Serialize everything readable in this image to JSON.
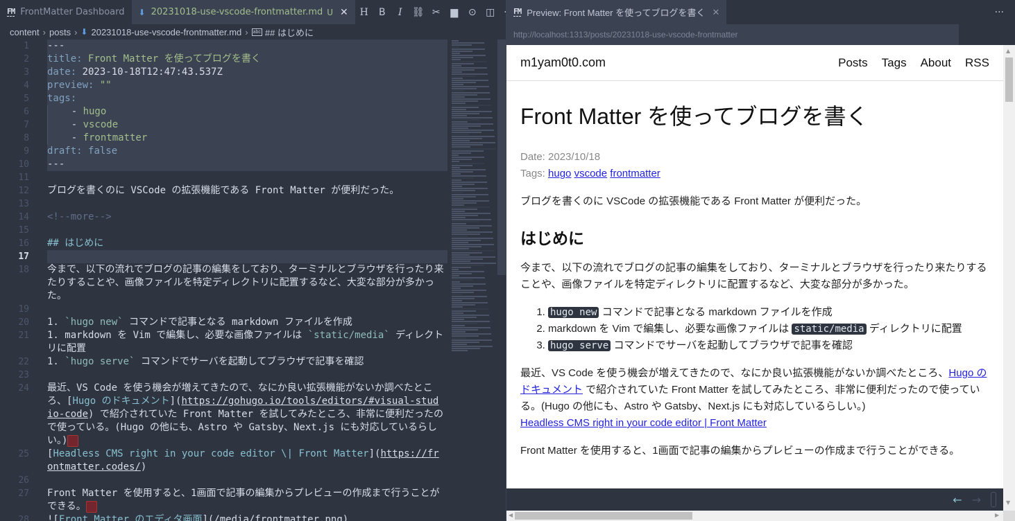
{
  "left_tabs": [
    {
      "label": "FrontMatter Dashboard",
      "icon": "fm-logo"
    },
    {
      "label": "20231018-use-vscode-frontmatter.md",
      "icon": "markdown-icon",
      "modified_badge": "U",
      "active": true
    }
  ],
  "toolbar": [
    {
      "name": "heading",
      "glyph": "H"
    },
    {
      "name": "bold",
      "glyph": "B"
    },
    {
      "name": "italic",
      "glyph": "I"
    },
    {
      "name": "link",
      "glyph": "⛓"
    },
    {
      "name": "cut",
      "glyph": "✂"
    },
    {
      "name": "image",
      "glyph": "▆"
    },
    {
      "name": "snippet",
      "glyph": "⊙"
    },
    {
      "name": "split-editor",
      "glyph": "◫"
    },
    {
      "name": "more",
      "glyph": "···"
    }
  ],
  "breadcrumb": [
    "content",
    "posts",
    "20231018-use-vscode-frontmatter.md",
    "## はじめに"
  ],
  "editor": {
    "current_line": 17,
    "lines": {
      "l1": "---",
      "l2_key": "title",
      "l2_val": "Front Matter を使ってブログを書く",
      "l3_key": "date",
      "l3_val": "2023-10-18T12:47:43.537Z",
      "l4_key": "preview",
      "l4_val": "\"\"",
      "l5_key": "tags",
      "l6": "hugo",
      "l7": "vscode",
      "l8": "frontmatter",
      "l9_key": "draft",
      "l9_val": "false",
      "l10": "---",
      "l12": "ブログを書くのに VSCode の拡張機能である Front Matter が便利だった。",
      "l14": "<!--more-->",
      "l16": "## はじめに",
      "l18": "今まで、以下の流れでブログの記事の編集をしており、ターミナルとブラウザを行ったり来たりすることや、画像ファイルを特定ディレクトリに配置するなど、大変な部分が多かった。",
      "l20_a": "1. ",
      "l20_code": "`hugo new`",
      "l20_b": " コマンドで記事となる markdown ファイルを作成",
      "l21_a": "1. markdown を Vim で編集し、必要な画像ファイルは ",
      "l21_code": "`static/media`",
      "l21_b": " ディレクトリに配置",
      "l22_a": "1. ",
      "l22_code": "`hugo serve`",
      "l22_b": " コマンドでサーバを起動してブラウザで記事を確認",
      "l24_a": "最近、VS Code を使う機会が増えてきたので、なにか良い拡張機能がないか調べたところ、[",
      "l24_linktext": "Hugo のドキュメント",
      "l24_b": "](",
      "l24_url": "https://gohugo.io/tools/editors/#visual-studio-code",
      "l24_c": ") で紹介されていた Front Matter を試してみたところ、非常に便利だったので使っている。(Hugo の他にも、Astro や Gatsby、Next.js にも対応しているらしい。)",
      "l25_a": "[",
      "l25_linktext": "Headless CMS right in your code editor \\| Front Matter",
      "l25_b": "](",
      "l25_url": "https://frontmatter.codes/",
      "l25_c": ")",
      "l27": "Front Matter を使用すると、1画面で記事の編集からプレビューの作成まで行うことができる。",
      "l28_a": "![",
      "l28_linktext": "Front Matter のエディタ画面",
      "l28_b": "](/media/frontmatter.png)"
    }
  },
  "preview": {
    "tab_label": "Preview: Front Matter を使ってブログを書く",
    "url": "http://localhost:1313/posts/20231018-use-vscode-frontmatter",
    "site_title": "m1yam0t0.com",
    "nav": [
      "Posts",
      "Tags",
      "About",
      "RSS"
    ],
    "title": "Front Matter を使ってブログを書く",
    "date_label": "Date: 2023/10/18",
    "tags_label": "Tags:",
    "tags": [
      "hugo",
      "vscode",
      "frontmatter"
    ],
    "intro": "ブログを書くのに VSCode の拡張機能である Front Matter が便利だった。",
    "h2": "はじめに",
    "p1": "今まで、以下の流れでブログの記事の編集をしており、ターミナルとブラウザを行ったり来たりすることや、画像ファイルを特定ディレクトリに配置するなど、大変な部分が多かった。",
    "list": [
      {
        "code": "hugo new",
        "text": " コマンドで記事となる markdown ファイルを作成"
      },
      {
        "pre": "markdown を Vim で編集し、必要な画像ファイルは ",
        "code": "static/media",
        "text": " ディレクトリに配置"
      },
      {
        "code": "hugo serve",
        "text": " コマンドでサーバを起動してブラウザで記事を確認"
      }
    ],
    "p2_a": "最近、VS Code を使う機会が増えてきたので、なにか良い拡張機能がないか調べたところ、",
    "p2_link": "Hugo のドキュメント",
    "p2_b": " で紹介されていた Front Matter を試してみたところ、非常に便利だったので使っている。(Hugo の他にも、Astro や Gatsby、Next.js にも対応しているらしい。)",
    "p2_link2": "Headless CMS right in your code editor | Front Matter",
    "p3": "Front Matter を使用すると、1画面で記事の編集からプレビューの作成まで行うことができる。"
  }
}
